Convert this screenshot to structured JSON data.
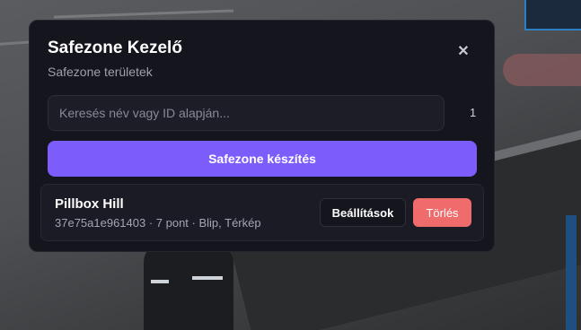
{
  "modal": {
    "title": "Safezone Kezelő",
    "subtitle": "Safezone területek",
    "close_icon": "close-icon",
    "search": {
      "placeholder": "Keresés név vagy ID alapján...",
      "value": ""
    },
    "count": "1",
    "create_label": "Safezone készítés",
    "zones": [
      {
        "name": "Pillbox Hill",
        "meta": "37e75a1e961403 · 7 pont · Blip, Térkép",
        "settings_label": "Beállítások",
        "delete_label": "Törlés"
      }
    ]
  },
  "colors": {
    "panel_bg": "#14151d",
    "accent": "#7c5cfb",
    "danger": "#f06b6b"
  }
}
